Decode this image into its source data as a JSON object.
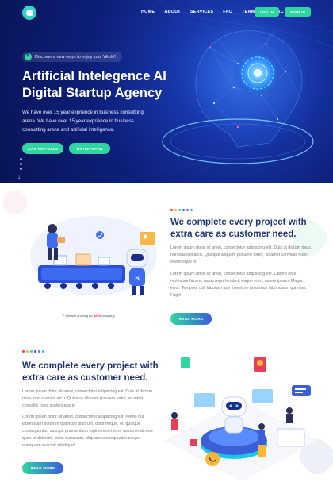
{
  "nav": {
    "items": [
      "HOME",
      "ABOUT",
      "SERVICES",
      "FAQ",
      "TEAM",
      "CONTACT"
    ],
    "login_label": "LOG IN",
    "signup_label": "SIGNUP"
  },
  "hero": {
    "pill_text": "Discover a new ways to enjoy your World!",
    "title_line1": "Artificial Intelegence AI",
    "title_line2": "Digital Startup Agency",
    "description": "We have over 15 year exprience in business consultting arena. We have over 15 year exprience in business consultting arena and artificial intelligence.",
    "join_label": "JOIN PRE-SALE",
    "whitepaper_label": "WHITEPAPER"
  },
  "section2": {
    "title": "We complete every project with extra care as customer need.",
    "paragraph1": "Lorem ipsum dolor sit amet, consectetur adipiscing elit. Duis at dictum risus, non suscipit arcu. Quisque aliquam posuere tortor, sit amet convallis nunc scelerisque in.",
    "paragraph2": "Lorem ipsum dolor sit amet, consectetur adipiscing elit. Labore eius molestiae facere, natus reprehenderit eaque eum, autem ipsam. Magni, error. Tempora odit laborum iure inventore possimus laboriosam qui nam. Fugit!",
    "caption_prefix": "* Already growing up",
    "caption_amount": "$25K",
    "caption_suffix": "company",
    "read_more_label": "READ MORE"
  },
  "section3": {
    "title": "We complete every project with extra care as customer need.",
    "paragraph1": "Lorem ipsum dolor sit amet, consectetur adipiscing elit. Duis at dictum risus, non suscipit arcu. Quisque aliquam posuere tortor, sit amet convallis nunc scelerisque in.",
    "paragraph2": "Lorem ipsum dolor sit amet, consectetur adipiscing elit. Nemo qui laboriosam dolorum distinctio dolorum, doloremque, et, quisque consequuntur, suscipit praesentium fugit eveniet error assumenda eos quae ut dolorum, cum, quisquam, aliquam consequuntur saepe numquam suscipit similique!",
    "read_more_label": "READ MORE"
  },
  "colors": {
    "hero_bg": "#0d1f7a",
    "accent_green": "#2fd6a0",
    "heading_blue": "#1f3577",
    "body_text": "#777777",
    "dot_palette": [
      "#e83e57",
      "#f7b733",
      "#2fd6a0",
      "#3a5fd8",
      "#9b59b6",
      "#1bc7e6"
    ]
  }
}
